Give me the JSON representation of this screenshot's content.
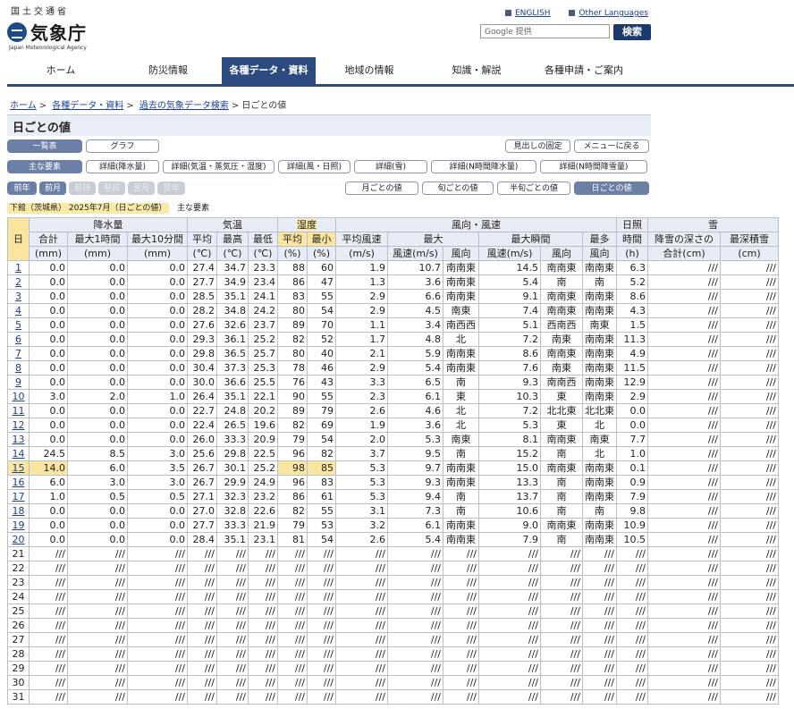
{
  "header": {
    "ministry": "国土交通省",
    "agency": "気象庁",
    "agency_en": "Japan Meteorological Agency",
    "english": "ENGLISH",
    "other_lang": "Other Languages",
    "search_placeholder": "Google 提供",
    "search_button": "検索"
  },
  "nav": [
    "ホーム",
    "防災情報",
    "各種データ・資料",
    "地域の情報",
    "知識・解説",
    "各種申請・ご案内"
  ],
  "breadcrumb": [
    "ホーム",
    "各種データ・資料",
    "過去の気象データ検索",
    "日ごとの値"
  ],
  "page_title": "日ごとの値",
  "buttons": {
    "list": "一覧表",
    "graph": "グラフ",
    "fix_header": "見出しの固定",
    "back_menu": "メニューに戻る",
    "main": "主な要素",
    "d_rain": "詳細(降水量)",
    "d_temp": "詳細(気温・蒸気圧・湿度)",
    "d_wind": "詳細(風・日照)",
    "d_snow": "詳細(雪)",
    "d_nrain": "詳細(N時間降水量)",
    "d_nsnow": "詳細(N時間降雪量)",
    "prev_year": "前年",
    "prev_month": "前月",
    "prev_day": "前日",
    "next_day": "翌日",
    "next_month": "翌月",
    "next_year": "翌年",
    "monthly": "月ごとの値",
    "dekad": "旬ごとの値",
    "half_dekad": "半旬ごとの値",
    "daily": "日ごとの値"
  },
  "location": "下館（茨城県） 2025年7月（日ごとの値）",
  "location_sub": "主な要素",
  "table": {
    "h_day": "日",
    "h_rain": "降水量",
    "h_temp": "気温",
    "h_hum": "湿度",
    "h_wind": "風向・風速",
    "h_sun": "日照",
    "h_snow": "雪",
    "h_total": "合計",
    "h_max1h": "最大1時間",
    "h_max10": "最大10分間",
    "h_avg": "平均",
    "h_high": "最高",
    "h_low": "最低",
    "h_havg": "平均",
    "h_hmin": "最小",
    "h_wavg": "平均風速",
    "h_wmax": "最大",
    "h_wgust": "最大瞬間",
    "h_wmost": "最多",
    "h_suntime": "時間",
    "h_snowdepth": "降雪の深さの",
    "h_snowmax": "最深積雪",
    "u_mm": "(mm)",
    "u_c": "(℃)",
    "u_pct": "(%)",
    "u_ms": "(m/s)",
    "u_speed": "風速(m/s)",
    "u_dir": "風向",
    "u_most": "風向",
    "u_h": "(h)",
    "u_cm_total": "合計(cm)",
    "u_cm": "(cm)",
    "rows": [
      [
        "1",
        "0.0",
        "0.0",
        "0.0",
        "27.4",
        "34.7",
        "23.3",
        "88",
        "60",
        "1.9",
        "10.7",
        "南南東",
        "14.5",
        "南南東",
        "南南東",
        "6.3",
        "///",
        "///"
      ],
      [
        "2",
        "0.0",
        "0.0",
        "0.0",
        "27.7",
        "34.9",
        "23.4",
        "86",
        "47",
        "1.3",
        "3.6",
        "南南東",
        "5.4",
        "南",
        "南",
        "5.2",
        "///",
        "///"
      ],
      [
        "3",
        "0.0",
        "0.0",
        "0.0",
        "28.5",
        "35.1",
        "24.1",
        "83",
        "55",
        "2.9",
        "6.6",
        "南南東",
        "9.1",
        "南南東",
        "南南東",
        "8.6",
        "///",
        "///"
      ],
      [
        "4",
        "0.0",
        "0.0",
        "0.0",
        "28.2",
        "34.8",
        "24.2",
        "80",
        "54",
        "2.9",
        "4.5",
        "南東",
        "7.4",
        "南南東",
        "南南東",
        "4.3",
        "///",
        "///"
      ],
      [
        "5",
        "0.0",
        "0.0",
        "0.0",
        "27.6",
        "32.6",
        "23.7",
        "89",
        "70",
        "1.1",
        "3.4",
        "南西西",
        "5.1",
        "西南西",
        "南東",
        "1.5",
        "///",
        "///"
      ],
      [
        "6",
        "0.0",
        "0.0",
        "0.0",
        "29.3",
        "36.1",
        "25.2",
        "82",
        "52",
        "1.7",
        "4.8",
        "北",
        "7.2",
        "南東",
        "南南東",
        "11.3",
        "///",
        "///"
      ],
      [
        "7",
        "0.0",
        "0.0",
        "0.0",
        "29.8",
        "36.5",
        "25.7",
        "80",
        "40",
        "2.1",
        "5.9",
        "南南東",
        "8.6",
        "南南東",
        "南南東",
        "4.9",
        "///",
        "///"
      ],
      [
        "8",
        "0.0",
        "0.0",
        "0.0",
        "30.4",
        "37.3",
        "25.3",
        "78",
        "46",
        "2.9",
        "5.4",
        "南南東",
        "7.6",
        "南東",
        "南南東",
        "11.5",
        "///",
        "///"
      ],
      [
        "9",
        "0.0",
        "0.0",
        "0.0",
        "30.0",
        "36.6",
        "25.5",
        "76",
        "43",
        "3.3",
        "6.5",
        "南",
        "9.3",
        "南南西",
        "南南東",
        "12.9",
        "///",
        "///"
      ],
      [
        "10",
        "3.0",
        "2.0",
        "1.0",
        "26.4",
        "35.1",
        "22.1",
        "90",
        "55",
        "2.3",
        "6.1",
        "東",
        "10.3",
        "東",
        "南南東",
        "2.9",
        "///",
        "///"
      ],
      [
        "11",
        "0.0",
        "0.0",
        "0.0",
        "22.7",
        "24.8",
        "20.2",
        "89",
        "79",
        "2.6",
        "4.6",
        "北",
        "7.2",
        "北北東",
        "北北東",
        "0.0",
        "///",
        "///"
      ],
      [
        "12",
        "0.0",
        "0.0",
        "0.0",
        "22.4",
        "26.5",
        "19.6",
        "82",
        "69",
        "1.9",
        "3.6",
        "北",
        "5.3",
        "東",
        "北",
        "0.0",
        "///",
        "///"
      ],
      [
        "13",
        "0.0",
        "0.0",
        "0.0",
        "26.0",
        "33.3",
        "20.9",
        "79",
        "54",
        "2.0",
        "5.3",
        "南東",
        "8.1",
        "南南東",
        "南東",
        "7.7",
        "///",
        "///"
      ],
      [
        "14",
        "24.5",
        "8.5",
        "3.0",
        "25.6",
        "29.8",
        "22.5",
        "96",
        "82",
        "3.7",
        "9.5",
        "南",
        "15.2",
        "南",
        "北",
        "1.0",
        "///",
        "///"
      ],
      [
        "15",
        "14.0",
        "6.0",
        "3.5",
        "26.7",
        "30.1",
        "25.2",
        "98",
        "85",
        "5.3",
        "9.7",
        "南南東",
        "15.0",
        "南南東",
        "南南東",
        "0.1",
        "///",
        "///"
      ],
      [
        "16",
        "6.0",
        "3.0",
        "3.0",
        "26.7",
        "29.9",
        "24.9",
        "96",
        "83",
        "5.3",
        "9.3",
        "南南東",
        "13.3",
        "南",
        "南南東",
        "0.9",
        "///",
        "///"
      ],
      [
        "17",
        "1.0",
        "0.5",
        "0.5",
        "27.1",
        "32.3",
        "23.2",
        "86",
        "61",
        "5.3",
        "9.4",
        "南",
        "13.7",
        "南",
        "南南東",
        "7.9",
        "///",
        "///"
      ],
      [
        "18",
        "0.0",
        "0.0",
        "0.0",
        "27.0",
        "32.8",
        "22.6",
        "82",
        "55",
        "3.1",
        "7.3",
        "南",
        "10.6",
        "南",
        "南",
        "9.8",
        "///",
        "///"
      ],
      [
        "19",
        "0.0",
        "0.0",
        "0.0",
        "27.7",
        "33.3",
        "21.9",
        "79",
        "53",
        "3.2",
        "6.1",
        "南南東",
        "9.0",
        "南南東",
        "南南東",
        "10.9",
        "///",
        "///"
      ],
      [
        "20",
        "0.0",
        "0.0",
        "0.0",
        "28.4",
        "35.1",
        "23.1",
        "81",
        "54",
        "2.6",
        "5.4",
        "南南東",
        "7.9",
        "南",
        "南南東",
        "10.5",
        "///",
        "///"
      ],
      [
        "21",
        "///",
        "///",
        "///",
        "///",
        "///",
        "///",
        "///",
        "///",
        "///",
        "///",
        "///",
        "///",
        "///",
        "///",
        "///",
        "///",
        "///"
      ],
      [
        "22",
        "///",
        "///",
        "///",
        "///",
        "///",
        "///",
        "///",
        "///",
        "///",
        "///",
        "///",
        "///",
        "///",
        "///",
        "///",
        "///",
        "///"
      ],
      [
        "23",
        "///",
        "///",
        "///",
        "///",
        "///",
        "///",
        "///",
        "///",
        "///",
        "///",
        "///",
        "///",
        "///",
        "///",
        "///",
        "///",
        "///"
      ],
      [
        "24",
        "///",
        "///",
        "///",
        "///",
        "///",
        "///",
        "///",
        "///",
        "///",
        "///",
        "///",
        "///",
        "///",
        "///",
        "///",
        "///",
        "///"
      ],
      [
        "25",
        "///",
        "///",
        "///",
        "///",
        "///",
        "///",
        "///",
        "///",
        "///",
        "///",
        "///",
        "///",
        "///",
        "///",
        "///",
        "///",
        "///"
      ],
      [
        "26",
        "///",
        "///",
        "///",
        "///",
        "///",
        "///",
        "///",
        "///",
        "///",
        "///",
        "///",
        "///",
        "///",
        "///",
        "///",
        "///",
        "///"
      ],
      [
        "27",
        "///",
        "///",
        "///",
        "///",
        "///",
        "///",
        "///",
        "///",
        "///",
        "///",
        "///",
        "///",
        "///",
        "///",
        "///",
        "///",
        "///"
      ],
      [
        "28",
        "///",
        "///",
        "///",
        "///",
        "///",
        "///",
        "///",
        "///",
        "///",
        "///",
        "///",
        "///",
        "///",
        "///",
        "///",
        "///",
        "///"
      ],
      [
        "29",
        "///",
        "///",
        "///",
        "///",
        "///",
        "///",
        "///",
        "///",
        "///",
        "///",
        "///",
        "///",
        "///",
        "///",
        "///",
        "///",
        "///"
      ],
      [
        "30",
        "///",
        "///",
        "///",
        "///",
        "///",
        "///",
        "///",
        "///",
        "///",
        "///",
        "///",
        "///",
        "///",
        "///",
        "///",
        "///",
        "///"
      ],
      [
        "31",
        "///",
        "///",
        "///",
        "///",
        "///",
        "///",
        "///",
        "///",
        "///",
        "///",
        "///",
        "///",
        "///",
        "///",
        "///",
        "///",
        "///"
      ]
    ]
  }
}
